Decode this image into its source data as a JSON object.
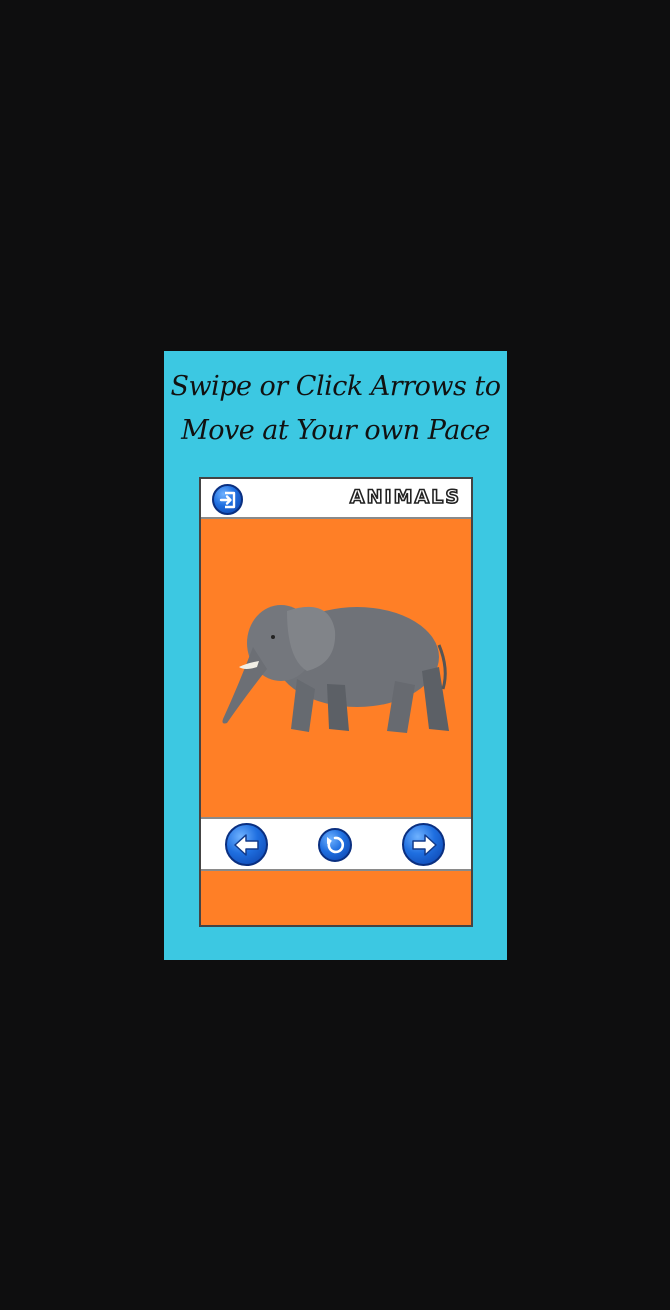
{
  "promo": {
    "headline_line1": "Swipe or Click Arrows to",
    "headline_line2": "Move at Your own Pace"
  },
  "app": {
    "title": "ANIMALS",
    "current_image": "elephant",
    "icons": {
      "exit": "exit-icon",
      "previous": "arrow-left-icon",
      "replay": "replay-icon",
      "next": "arrow-right-icon"
    }
  },
  "colors": {
    "background": "#0e0e0f",
    "card": "#3cc8e2",
    "app_background": "#ff7f26",
    "button_blue": "#1f6fe0"
  }
}
